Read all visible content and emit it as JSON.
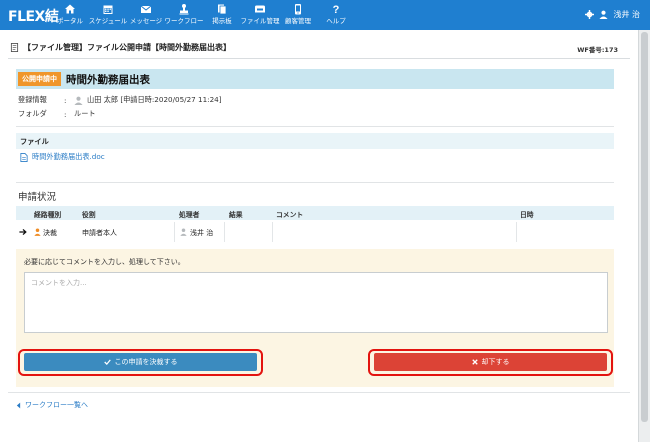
{
  "app": {
    "logo": "FLEX結",
    "user_name": "浅井 治"
  },
  "nav": [
    {
      "label": "ポータル",
      "icon": "home-icon"
    },
    {
      "label": "スケジュール",
      "icon": "calendar-icon"
    },
    {
      "label": "メッセージ",
      "icon": "mail-icon"
    },
    {
      "label": "ワークフロー",
      "icon": "stamp-icon"
    },
    {
      "label": "掲示板",
      "icon": "board-icon"
    },
    {
      "label": "ファイル管理",
      "icon": "folder-icon"
    },
    {
      "label": "顧客管理",
      "icon": "phone-icon"
    },
    {
      "label": "ヘルプ",
      "icon": "help-icon"
    }
  ],
  "header": {
    "title": "【ファイル管理】ファイル公開申請【時間外勤務届出表】",
    "wf_number": "WF番号:173"
  },
  "document": {
    "badge": "公開申請中",
    "title": "時間外勤務届出表",
    "registration_label": "登録情報",
    "registration_value": "山田 太郎 [申請日時:2020/05/27 11:24]",
    "folder_label": "フォルダ",
    "folder_value": "ルート",
    "colon": ":"
  },
  "file": {
    "section_label": "ファイル",
    "filename": "時間外勤務届出表.doc"
  },
  "status": {
    "section_title": "申請状況",
    "columns": {
      "route": "経路種別",
      "role": "役割",
      "handler": "処理者",
      "result": "結果",
      "comment": "コメント",
      "datetime": "日時"
    },
    "row": {
      "route": "決裁",
      "role": "申請者本人",
      "handler": "浅井 治",
      "result": "",
      "comment": "",
      "datetime": ""
    }
  },
  "action": {
    "prompt": "必要に応じてコメントを入力し、処理して下さい。",
    "comment_placeholder": "コメントを入力...",
    "approve_label": "この申請を決裁する",
    "reject_label": "却下する"
  },
  "footer": {
    "back_link": "ワークフロー一覧へ"
  },
  "colors": {
    "topbar": "#1f7fd0",
    "badge": "#f0962b",
    "approve": "#3b8bbf",
    "reject": "#dc4336",
    "highlight_ring": "#e3130f"
  }
}
